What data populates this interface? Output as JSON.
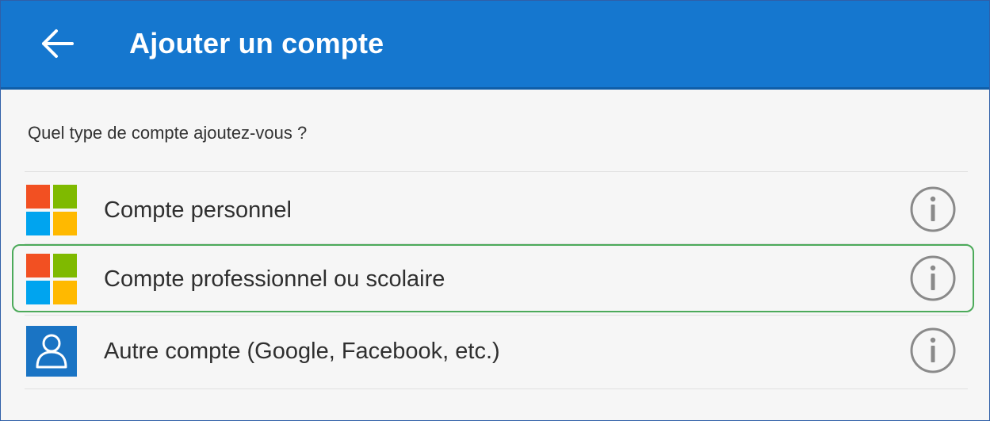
{
  "header": {
    "title": "Ajouter un compte",
    "back_icon": "arrow-left-icon",
    "background_color": "#1577cf"
  },
  "prompt": "Quel type de compte ajoutez-vous ?",
  "accounts": [
    {
      "label": "Compte personnel",
      "icon": "microsoft-logo-icon",
      "selected": false
    },
    {
      "label": "Compte professionnel ou scolaire",
      "icon": "microsoft-logo-icon",
      "selected": true
    },
    {
      "label": "Autre compte (Google, Facebook, etc.)",
      "icon": "person-icon",
      "selected": false
    }
  ],
  "info_icon": "info-icon",
  "colors": {
    "accent": "#1577cf",
    "selection_border": "#4caa5a",
    "ms_red": "#f25022",
    "ms_green": "#7fba00",
    "ms_blue": "#00a4ef",
    "ms_yellow": "#ffb900"
  }
}
